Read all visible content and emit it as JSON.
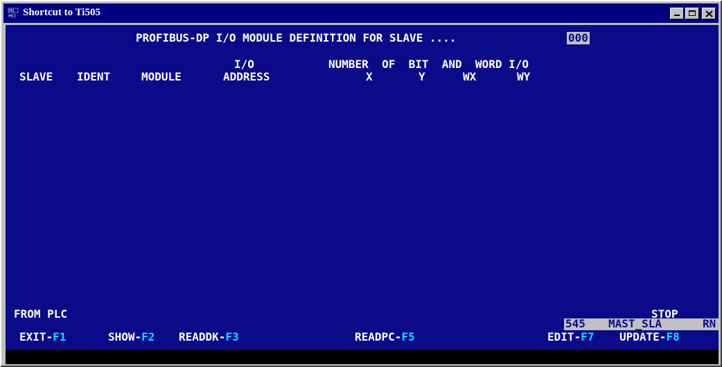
{
  "window": {
    "title": "Shortcut to Ti505",
    "icon": "ms-dos-icon"
  },
  "screen": {
    "heading": "PROFIBUS-DP I/O MODULE DEFINITION FOR SLAVE ....",
    "slave_number": "000",
    "columns": {
      "slave": "SLAVE",
      "ident": "IDENT",
      "module": "MODULE",
      "io_top": "I/O",
      "address": "ADDRESS",
      "number_of": "NUMBER  OF  BIT  AND  WORD I/O",
      "x": "X",
      "y": "Y",
      "wx": "WX",
      "wy": "WY"
    },
    "from_plc": "FROM PLC",
    "state": "STOP",
    "status": {
      "model": "545",
      "mode": "MAST_SLA",
      "run": "RN"
    },
    "function_keys": [
      {
        "label": "EXIT-",
        "key": "F1"
      },
      {
        "label": "SHOW-",
        "key": "F2"
      },
      {
        "label": "READDK-",
        "key": "F3"
      },
      {
        "label": "READPC-",
        "key": "F5"
      },
      {
        "label": "EDIT-",
        "key": "F7"
      },
      {
        "label": "UPDATE-",
        "key": "F8"
      }
    ]
  }
}
